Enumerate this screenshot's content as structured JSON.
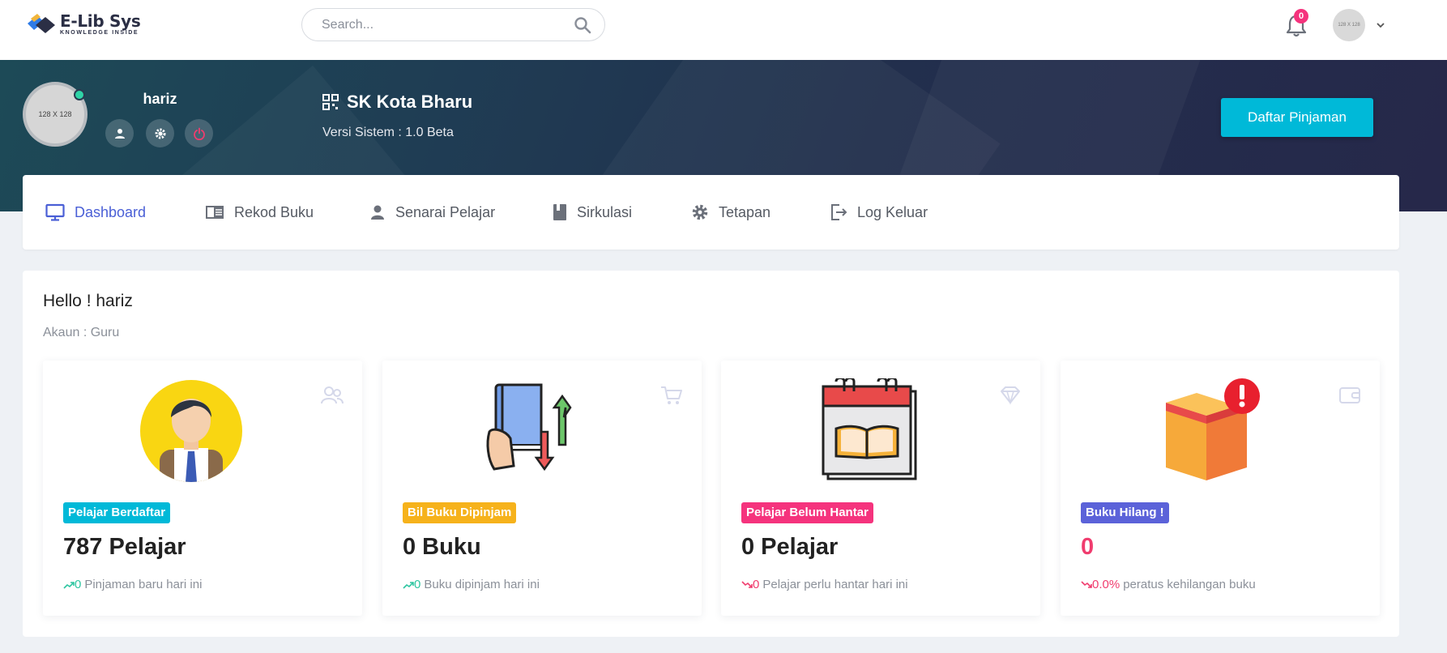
{
  "brand": {
    "name": "E-Lib Sys",
    "tagline": "KNOWLEDGE INSIDE"
  },
  "topbar": {
    "search_placeholder": "Search...",
    "notifications_count": "0",
    "avatar_placeholder": "128 X 128"
  },
  "profile": {
    "name": "hariz",
    "avatar_placeholder": "128 X 128",
    "status": "online"
  },
  "school": {
    "name": "SK Kota Bharu",
    "version": "Versi Sistem : 1.0 Beta"
  },
  "actions": {
    "daftar_label": "Daftar Pinjaman"
  },
  "menu": [
    {
      "label": "Dashboard",
      "icon": "monitor-icon",
      "active": true
    },
    {
      "label": "Rekod Buku",
      "icon": "id-card-icon",
      "active": false
    },
    {
      "label": "Senarai Pelajar",
      "icon": "user-icon",
      "active": false
    },
    {
      "label": "Sirkulasi",
      "icon": "book-icon",
      "active": false
    },
    {
      "label": "Tetapan",
      "icon": "gear-icon",
      "active": false
    },
    {
      "label": "Log Keluar",
      "icon": "logout-icon",
      "active": false
    }
  ],
  "greeting": {
    "hello": "Hello ! hariz",
    "account": "Akaun : Guru"
  },
  "stats": [
    {
      "badge": "Pelajar Berdaftar",
      "badge_color": "#00b9d8",
      "value": "787 Pelajar",
      "trend": "up",
      "trend_value": "0",
      "trend_text": "Pinjaman baru hari ini",
      "corner_icon": "users-icon",
      "illustration": "student-icon"
    },
    {
      "badge": "Bil Buku Dipinjam",
      "badge_color": "#f6b21b",
      "value": "0 Buku",
      "trend": "up",
      "trend_value": "0",
      "trend_text": "Buku dipinjam hari ini",
      "corner_icon": "cart-icon",
      "illustration": "book-exchange-icon"
    },
    {
      "badge": "Pelajar Belum Hantar",
      "badge_color": "#f5337d",
      "value": "0 Pelajar",
      "trend": "down",
      "trend_value": "0",
      "trend_text": "Pelajar perlu hantar hari ini",
      "corner_icon": "diamond-icon",
      "illustration": "calendar-book-icon"
    },
    {
      "badge": "Buku Hilang !",
      "badge_color": "#5b62d9",
      "value": "0",
      "value_color": "#f03c6e",
      "trend": "down",
      "trend_value": "0.0%",
      "trend_text": "peratus kehilangan buku",
      "corner_icon": "wallet-icon",
      "illustration": "lost-book-icon"
    }
  ],
  "colors": {
    "accent": "#4a5fd6",
    "cyan": "#00b9d8",
    "pink": "#f5337d",
    "up": "#2dc5a0",
    "down": "#f03c6e"
  }
}
